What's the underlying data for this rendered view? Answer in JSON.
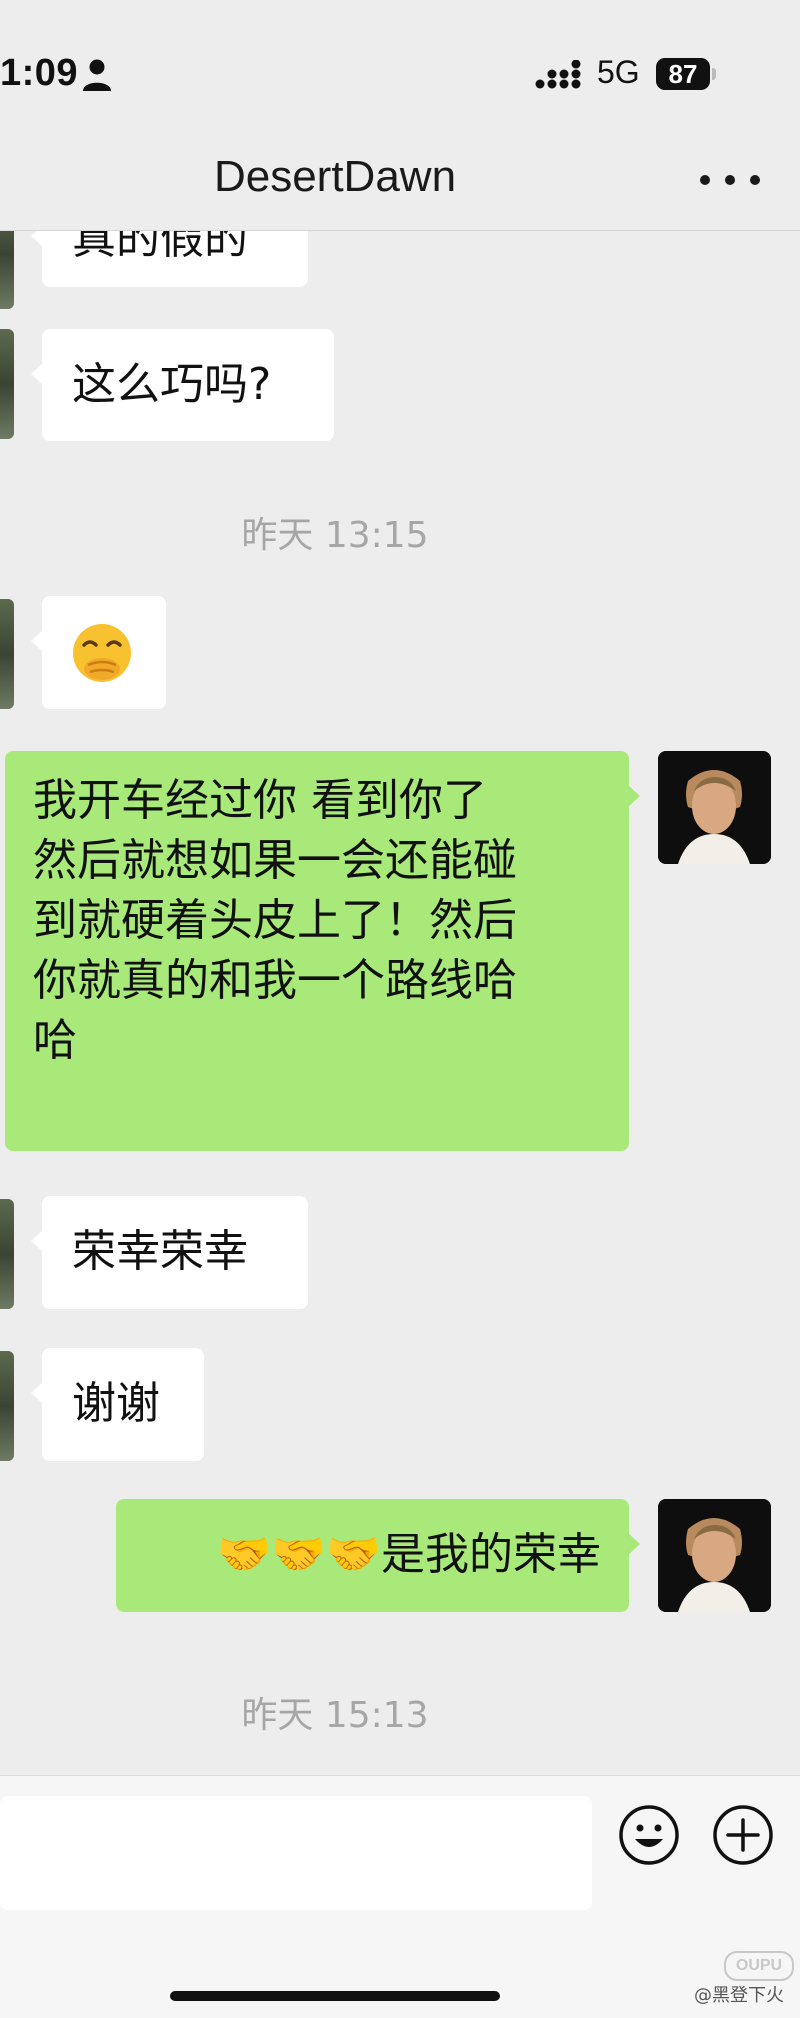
{
  "status_bar": {
    "time": "1:09",
    "network": "5G",
    "battery": "87"
  },
  "header": {
    "title": "DesertDawn"
  },
  "messages": [
    {
      "side": "in",
      "text": "真的假的"
    },
    {
      "side": "in",
      "text": "这么巧吗?"
    },
    {
      "type": "time",
      "text": "昨天 13:15"
    },
    {
      "side": "in",
      "text": "🤭"
    },
    {
      "side": "out",
      "text": "我开车经过你 看到你了\n然后就想如果一会还能碰\n到就硬着头皮上了！然后\n你就真的和我一个路线哈\n哈"
    },
    {
      "side": "in",
      "text": "荣幸荣幸"
    },
    {
      "side": "in",
      "text": "谢谢"
    },
    {
      "side": "out",
      "text": "🤝🤝🤝是我的荣幸"
    },
    {
      "type": "time",
      "text": "昨天 15:13"
    }
  ],
  "input": {
    "value": "",
    "placeholder": ""
  },
  "watermark": {
    "logo": "OUPU",
    "text": "@黑登下火"
  }
}
